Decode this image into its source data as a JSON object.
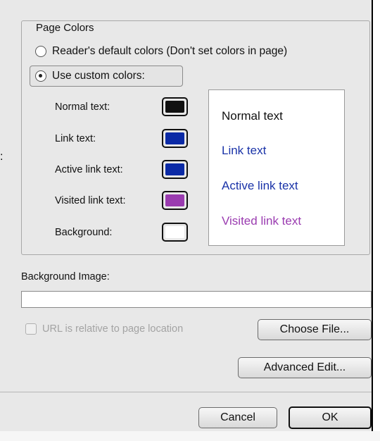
{
  "page_colors": {
    "title": "Page Colors",
    "radio_default": "Reader's default colors (Don't set colors in page)",
    "radio_custom": "Use custom colors:",
    "selected": "custom",
    "rows": [
      {
        "label": "Normal text:",
        "color": "#111111"
      },
      {
        "label": "Link text:",
        "color": "#0b2aa6"
      },
      {
        "label": "Active link text:",
        "color": "#0b2aa6"
      },
      {
        "label": "Visited link text:",
        "color": "#9a3bb0"
      },
      {
        "label": "Background:",
        "color": "#ffffff"
      }
    ],
    "preview": {
      "normal": "Normal text",
      "link": "Link text",
      "active": "Active link text",
      "visited": "Visited link text"
    }
  },
  "background_image": {
    "label": "Background Image:",
    "value": "",
    "relative_checkbox_label": "URL is relative to page location",
    "choose_file": "Choose File..."
  },
  "buttons": {
    "advanced_edit": "Advanced Edit...",
    "cancel": "Cancel",
    "ok": "OK"
  },
  "colors": {
    "link": "#1a33a8",
    "visited": "#9a3bb0"
  }
}
